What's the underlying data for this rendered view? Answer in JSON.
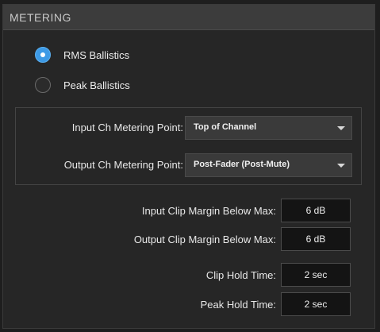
{
  "panel": {
    "title": "METERING"
  },
  "ballistics": {
    "options": [
      {
        "label": "RMS Ballistics",
        "selected": true
      },
      {
        "label": "Peak Ballistics",
        "selected": false
      }
    ]
  },
  "metering_points": {
    "input": {
      "label": "Input Ch Metering Point:",
      "value": "Top of Channel"
    },
    "output": {
      "label": "Output Ch Metering Point:",
      "value": "Post-Fader (Post-Mute)"
    }
  },
  "settings": {
    "input_clip_margin": {
      "label": "Input Clip Margin Below Max:",
      "value": "6 dB"
    },
    "output_clip_margin": {
      "label": "Output Clip Margin Below Max:",
      "value": "6 dB"
    },
    "clip_hold_time": {
      "label": "Clip Hold Time:",
      "value": "2 sec"
    },
    "peak_hold_time": {
      "label": "Peak Hold Time:",
      "value": "2 sec"
    }
  },
  "colors": {
    "accent": "#3d9ae6",
    "panel_bg": "#262626",
    "header_bg": "#3c3c3c"
  }
}
